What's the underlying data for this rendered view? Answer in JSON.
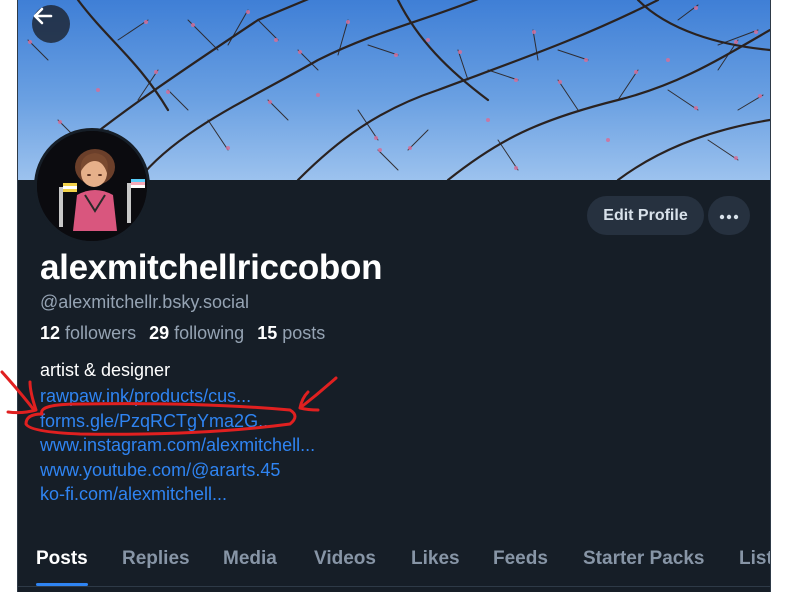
{
  "profile": {
    "display_name": "alexmitchellriccobon",
    "handle": "@alexmitchellr.bsky.social",
    "followers_count": "12",
    "followers_label": "followers",
    "following_count": "29",
    "following_label": "following",
    "posts_count": "15",
    "posts_label": "posts",
    "bio": "artist & designer",
    "links": [
      "rawpaw.ink/products/cus...",
      "forms.gle/PzqRCTgYma2G...",
      "www.instagram.com/alexmitchell...",
      "www.youtube.com/@ararts.45",
      "ko-fi.com/alexmitchell..."
    ]
  },
  "actions": {
    "edit_profile_label": "Edit Profile",
    "more_icon": "ellipsis-icon",
    "back_icon": "arrow-left-icon"
  },
  "tabs": [
    "Posts",
    "Replies",
    "Media",
    "Videos",
    "Likes",
    "Feeds",
    "Starter Packs",
    "Lists"
  ],
  "active_tab": "Posts",
  "colors": {
    "background": "#161e27",
    "link": "#2f84f2",
    "muted": "#95a3b3",
    "button": "#26313f",
    "annotation": "#e02020"
  }
}
